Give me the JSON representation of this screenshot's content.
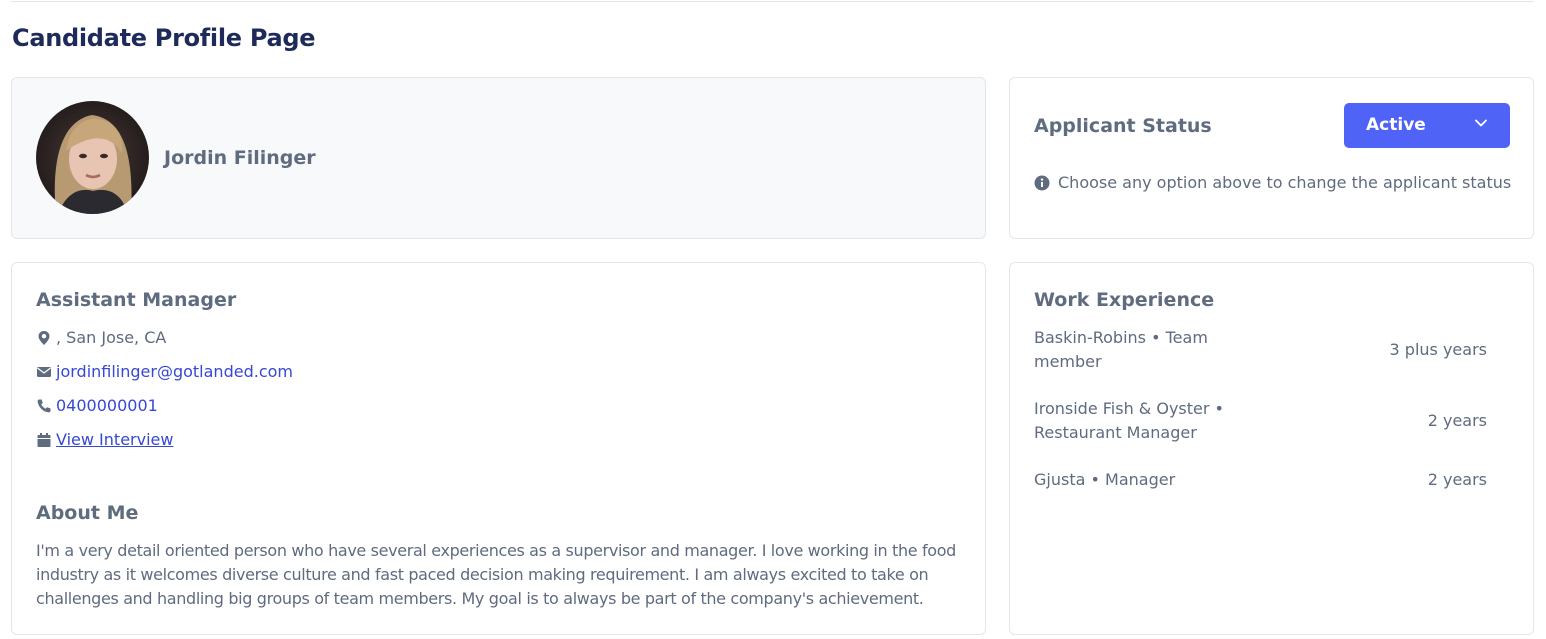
{
  "page": {
    "title": "Candidate Profile Page"
  },
  "profile": {
    "name": "Jordin Filinger"
  },
  "status": {
    "title": "Applicant Status",
    "selected": "Active",
    "hint": "Choose any option above to change the applicant status",
    "accent_color": "#4f63f7"
  },
  "details": {
    "job_title": "Assistant Manager",
    "location": ", San Jose, CA",
    "email": "jordinfilinger@gotlanded.com",
    "phone": "0400000001",
    "interview_link": "View Interview"
  },
  "about": {
    "title": "About Me",
    "text": "I'm a very detail oriented person who have several experiences as a supervisor and manager. I love working in the food industry as it welcomes diverse culture and fast paced decision making requirement. I am always excited to take on challenges and handling big groups of team members. My goal is to always be part of the company's achievement."
  },
  "work": {
    "title": "Work Experience",
    "items": [
      {
        "company": "Baskin-Robins • Team member",
        "duration": "3 plus years"
      },
      {
        "company": "Ironside Fish & Oyster • Restaurant Manager",
        "duration": "2 years"
      },
      {
        "company": "Gjusta • Manager",
        "duration": "2 years"
      }
    ]
  },
  "icons": {
    "location": "map-marker-icon",
    "email": "envelope-icon",
    "phone": "phone-icon",
    "interview": "calendar-icon",
    "info": "info-circle-icon",
    "dropdown": "chevron-down-icon"
  }
}
